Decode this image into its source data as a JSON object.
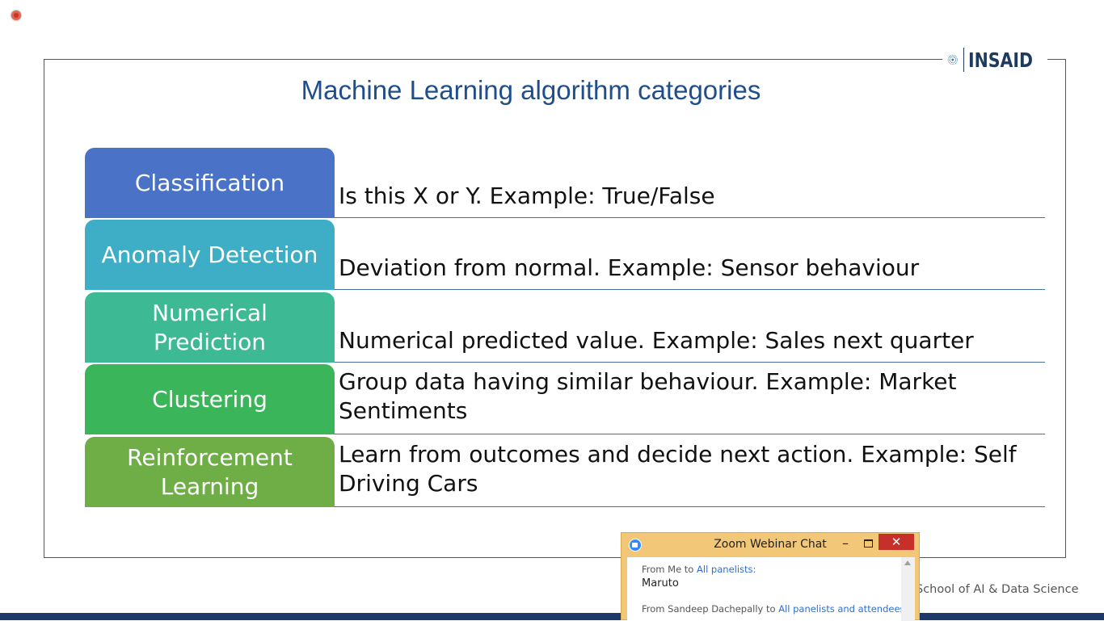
{
  "slide": {
    "title": "Machine Learning algorithm categories",
    "logo_text": "INSAID",
    "footer": "School of AI & Data Science",
    "rows": [
      {
        "category": "Classification",
        "color": "#4a72c6",
        "description": "Is this X or Y. Example: True/False"
      },
      {
        "category": "Anomaly Detection",
        "color": "#3eaec6",
        "description": "Deviation from normal. Example: Sensor behaviour"
      },
      {
        "category": "Numerical Prediction",
        "color": "#3dba93",
        "description": "Numerical predicted value. Example: Sales next quarter"
      },
      {
        "category": "Clustering",
        "color": "#3bb55a",
        "description": "Group data having similar behaviour. Example: Market Sentiments"
      },
      {
        "category": "Reinforcement Learning",
        "color": "#6fad46",
        "description": "Learn from outcomes and decide next action. Example:  Self Driving Cars"
      }
    ]
  },
  "zoom_chat": {
    "window_title": "Zoom Webinar Chat",
    "minimize": "–",
    "close": "✕",
    "messages": [
      {
        "from": "From Me to ",
        "to": "All panelists:",
        "text": "Maruto"
      },
      {
        "from": "From Sandeep Dachepally to ",
        "to": "All panelists and attendees:",
        "text": ""
      }
    ]
  },
  "colors": {
    "title": "#1f4e8c",
    "accent_bar": "#1d3869",
    "chat_frame": "#f2c777"
  }
}
